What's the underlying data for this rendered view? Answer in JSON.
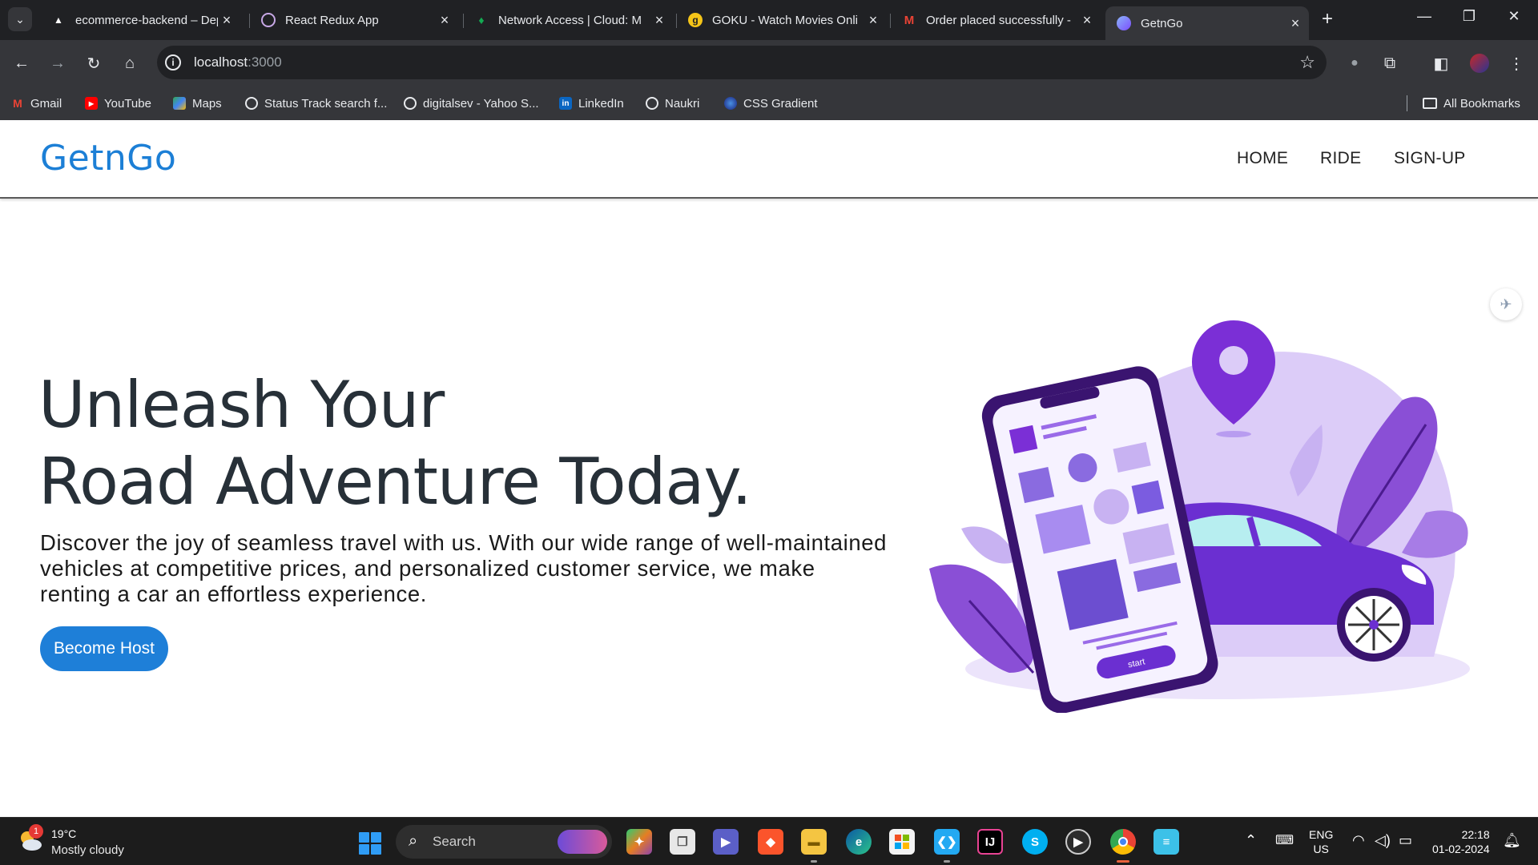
{
  "browser": {
    "tabs": [
      {
        "title": "ecommerce-backend – Dep",
        "icon": "vercel-icon",
        "color": "#ffffff"
      },
      {
        "title": "React Redux App",
        "icon": "redux-icon",
        "color": "#c7a8e6"
      },
      {
        "title": "Network Access | Cloud: M",
        "icon": "mongodb-leaf-icon",
        "color": "#13aa52"
      },
      {
        "title": "GOKU - Watch Movies Onli",
        "icon": "goku-icon",
        "color": "#f5c518"
      },
      {
        "title": "Order placed successfully -",
        "icon": "gmail-icon",
        "color": "#ea4335"
      },
      {
        "title": "GetnGo",
        "icon": "react-icon",
        "color": "#8ab4f8"
      }
    ],
    "url_host": "localhost",
    "url_port": ":3000",
    "bookmarks": [
      {
        "label": "Gmail",
        "icon": "gmail-icon",
        "color": "#ea4335"
      },
      {
        "label": "YouTube",
        "icon": "youtube-icon",
        "color": "#ff0000"
      },
      {
        "label": "Maps",
        "icon": "maps-icon",
        "color": "#34a853"
      },
      {
        "label": "Status Track search f...",
        "icon": "globe-icon",
        "color": "#e8eaed"
      },
      {
        "label": "digitalsev - Yahoo S...",
        "icon": "globe-icon",
        "color": "#e8eaed"
      },
      {
        "label": "LinkedIn",
        "icon": "linkedin-icon",
        "color": "#0a66c2"
      },
      {
        "label": "Naukri",
        "icon": "globe-icon",
        "color": "#e8eaed"
      },
      {
        "label": "CSS Gradient",
        "icon": "css-gradient-icon",
        "color": "#2b6cb0"
      }
    ],
    "all_bookmarks": "All Bookmarks"
  },
  "site": {
    "brand": "GetnGo",
    "brand_color": "#1c7fd6",
    "nav": [
      "HOME",
      "RIDE",
      "SIGN-UP"
    ],
    "hero": {
      "title_line1": "Unleash Your",
      "title_line2": "Road Adventure Today.",
      "description": "Discover the joy of seamless travel with us. With our wide range of well-maintained vehicles at competitive prices, and personalized customer service, we make renting a car an effortless experience.",
      "cta": "Become Host",
      "cta_color": "#1e7fd8"
    },
    "illustration_button": "start",
    "accent_purple": "#6b2fd1"
  },
  "taskbar": {
    "weather_badge": "1",
    "weather_temp": "19°C",
    "weather_condition": "Mostly cloudy",
    "search_label": "Search",
    "lang_line1": "ENG",
    "lang_line2": "US",
    "time": "22:18",
    "date": "01-02-2024"
  }
}
